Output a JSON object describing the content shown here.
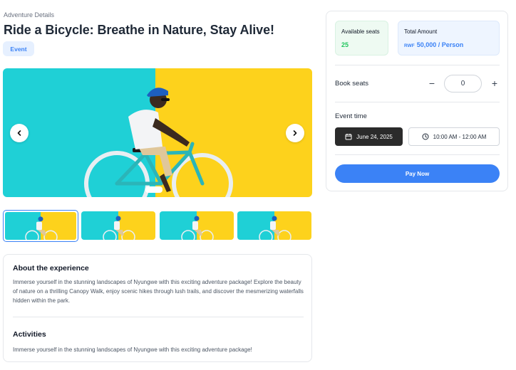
{
  "header": {
    "breadcrumb": "Adventure Details",
    "title": "Ride a Bicycle: Breathe in Nature, Stay Alive!",
    "tag": "Event"
  },
  "gallery": {
    "colors": {
      "left": "#1fd0d6",
      "right": "#fdd21c"
    },
    "prev_icon": "chevron-left-icon",
    "next_icon": "chevron-right-icon",
    "thumbnails": [
      {
        "selected": true
      },
      {
        "selected": false
      },
      {
        "selected": false
      },
      {
        "selected": false
      }
    ]
  },
  "about": {
    "heading": "About the experience",
    "text": "Immerse yourself in the stunning landscapes of Nyungwe with this exciting adventure package! Explore the beauty of nature on a thrilling Canopy Walk, enjoy scenic hikes through lush trails, and discover the mesmerizing waterfalls hidden within the park.",
    "activities_heading": "Activities",
    "activities_text": "Immerse yourself in the stunning landscapes of Nyungwe with this exciting adventure package!"
  },
  "booking": {
    "available_label": "Available seats",
    "available_value": "25",
    "total_label": "Total Amount",
    "currency": "RWF",
    "total_value": "50,000 / Person",
    "book_label": "Book seats",
    "minus": "−",
    "quantity": "0",
    "plus": "+",
    "event_time_label": "Event time",
    "date": "June 24, 2025",
    "time": "10:00 AM - 12:00 AM",
    "pay_label": "Pay Now"
  },
  "colors": {
    "accent": "#3b82f6",
    "success": "#22c55e",
    "dark_chip": "#2b2b2b"
  }
}
